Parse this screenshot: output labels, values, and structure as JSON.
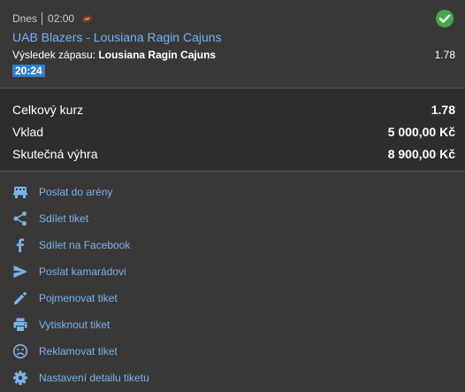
{
  "match": {
    "day": "Dnes",
    "time": "02:00",
    "sport_icon": "american-football-icon",
    "event": "UAB Blazers - Lousiana Ragin Cajuns",
    "market_label": "Výsledek zápasu:",
    "selection": "Lousiana Ragin Cajuns",
    "odds": "1.78",
    "live_time": "20:24",
    "status_icon": "check-circle-icon",
    "status_color": "#46a84a"
  },
  "summary": {
    "total_odds_label": "Celkový kurz",
    "total_odds_value": "1.78",
    "stake_label": "Vklad",
    "stake_value": "5 000,00 Kč",
    "payout_label": "Skutečná výhra",
    "payout_value": "8 900,00 Kč"
  },
  "actions": [
    {
      "label": "Poslat do arény",
      "icon": "arena-icon"
    },
    {
      "label": "Sdílet tiket",
      "icon": "share-icon"
    },
    {
      "label": "Sdílet na Facebook",
      "icon": "facebook-icon"
    },
    {
      "label": "Poslat kamarádovi",
      "icon": "send-icon"
    },
    {
      "label": "Pojmenovat tiket",
      "icon": "pencil-icon"
    },
    {
      "label": "Vytisknout tiket",
      "icon": "print-icon"
    },
    {
      "label": "Reklamovat tiket",
      "icon": "sad-face-icon"
    },
    {
      "label": "Nastavení detailu tiketu",
      "icon": "gear-icon"
    }
  ],
  "colors": {
    "accent_link": "#78b4f0",
    "event_title": "#6fb5ff",
    "badge_bg": "#2d7fd2",
    "panel_bg": "#3a3836",
    "summary_bg": "#2f2d2b"
  }
}
